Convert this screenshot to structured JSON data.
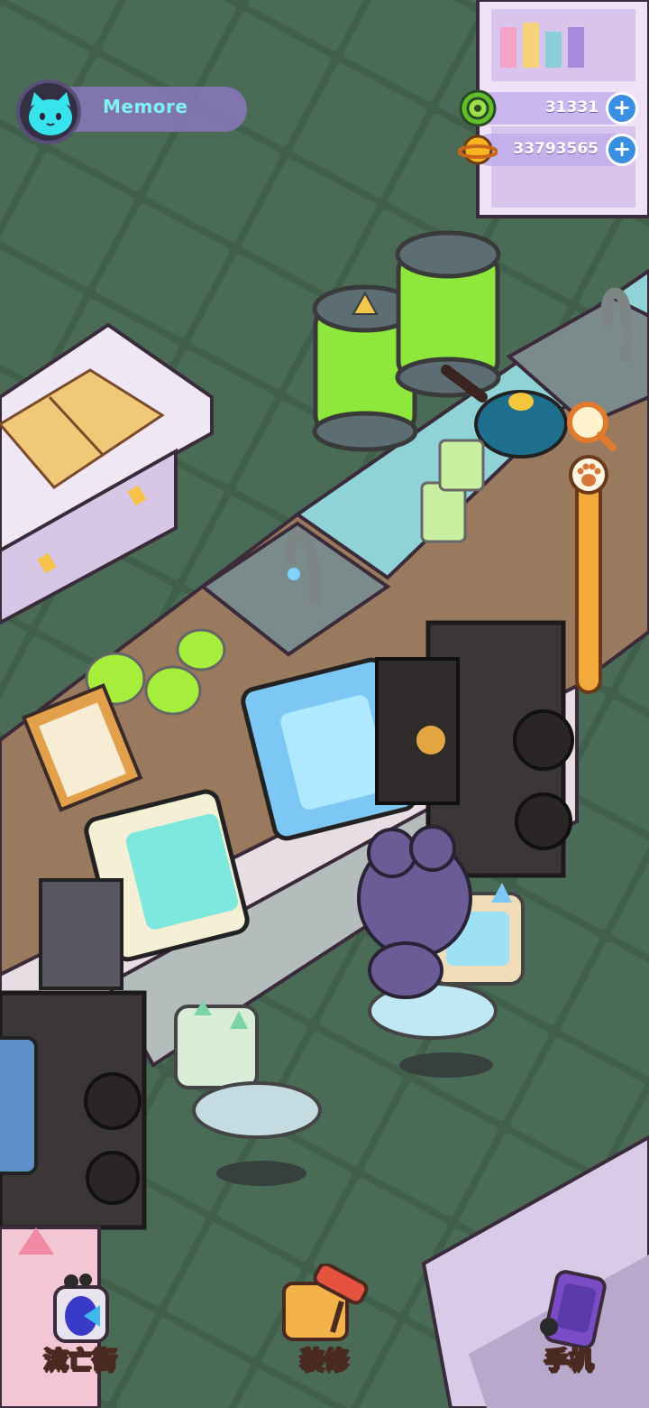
{
  "player": {
    "name": "Memore",
    "avatar_icon": "cat-face-icon"
  },
  "currencies": [
    {
      "id": "gem",
      "icon": "green-gear-coin-icon",
      "amount": "31331",
      "add_label": "+"
    },
    {
      "id": "coin",
      "icon": "planet-coin-icon",
      "amount": "33793565",
      "add_label": "+"
    }
  ],
  "zoom_control": {
    "icon": "magnifier-icon",
    "handle_icon": "paw-icon",
    "level": 0.95
  },
  "bottom_nav": {
    "street": {
      "label": "流亡街",
      "icon": "portal-icon"
    },
    "decorate": {
      "label": "装修",
      "icon": "paint-roller-icon"
    },
    "phone": {
      "label": "手机",
      "icon": "phone-icon"
    }
  },
  "colors": {
    "floor": "#3f5a48",
    "accent_blue": "#3a8fe0",
    "hud_purple": "#9178c8",
    "name_cyan": "#7ff3f2",
    "slider_orange": "#e79a3a"
  }
}
